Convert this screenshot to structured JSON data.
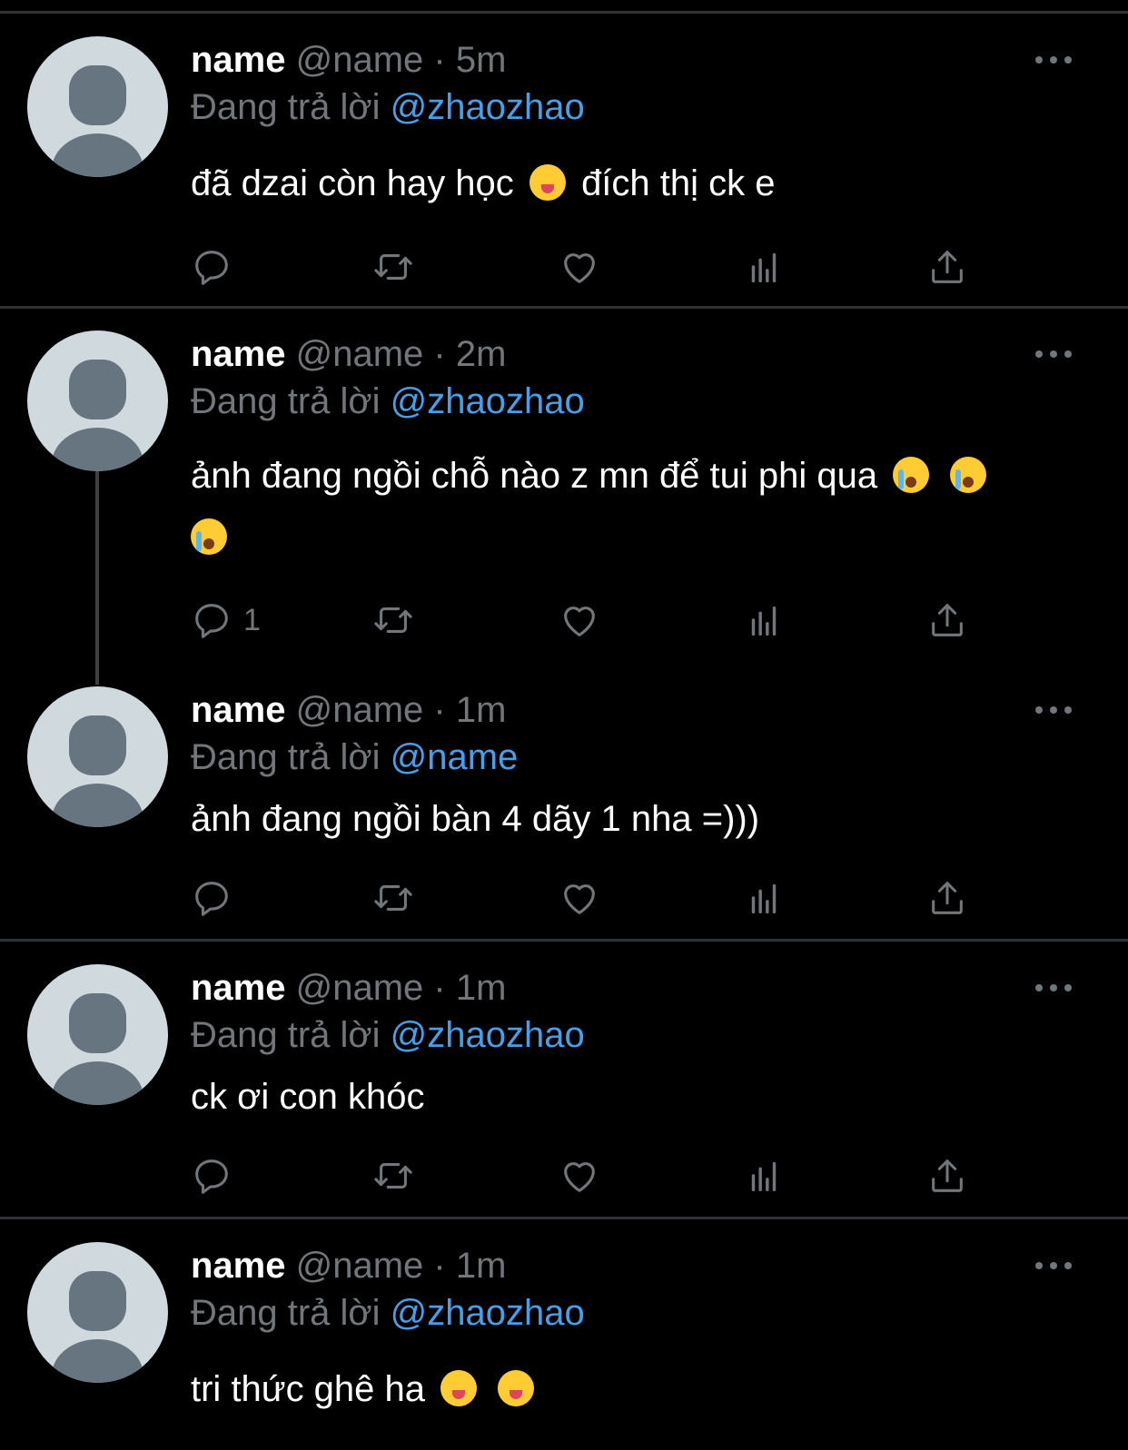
{
  "colors": {
    "background": "#000000",
    "divider": "#2f3336",
    "muted": "#71767b",
    "accent": "#4a9ee8",
    "avatar_bg": "#cfd9de",
    "avatar_fg": "#66757f"
  },
  "reply_prefix": "Đang trả lời",
  "tweets": [
    {
      "name": "name",
      "handle": "@name",
      "separator": "·",
      "time": "5m",
      "reply_to": "@zhaozhao",
      "text_parts": [
        "đã dzai còn hay học",
        "đích thị ck e"
      ],
      "emojis": [
        "face-savoring-food-emoji"
      ],
      "reply_count": ""
    },
    {
      "name": "name",
      "handle": "@name",
      "separator": "·",
      "time": "2m",
      "reply_to": "@zhaozhao",
      "text_parts": [
        "ảnh đang ngồi chỗ nào z mn để tui phi qua"
      ],
      "emojis": [
        "loudly-crying-face-emoji",
        "loudly-crying-face-emoji",
        "loudly-crying-face-emoji"
      ],
      "reply_count": "1"
    },
    {
      "name": "name",
      "handle": "@name",
      "separator": "·",
      "time": "1m",
      "reply_to": "@name",
      "text_parts": [
        "ảnh đang ngồi bàn 4 dãy 1 nha =)))"
      ],
      "emojis": [],
      "reply_count": ""
    },
    {
      "name": "name",
      "handle": "@name",
      "separator": "·",
      "time": "1m",
      "reply_to": "@zhaozhao",
      "text_parts": [
        "ck ơi con khóc"
      ],
      "emojis": [],
      "reply_count": ""
    },
    {
      "name": "name",
      "handle": "@name",
      "separator": "·",
      "time": "1m",
      "reply_to": "@zhaozhao",
      "text_parts": [
        "tri thức ghê ha"
      ],
      "emojis": [
        "face-savoring-food-emoji",
        "face-savoring-food-emoji"
      ],
      "reply_count": ""
    }
  ],
  "action_icons": [
    "reply-icon",
    "retweet-icon",
    "like-icon",
    "views-icon",
    "share-icon"
  ]
}
